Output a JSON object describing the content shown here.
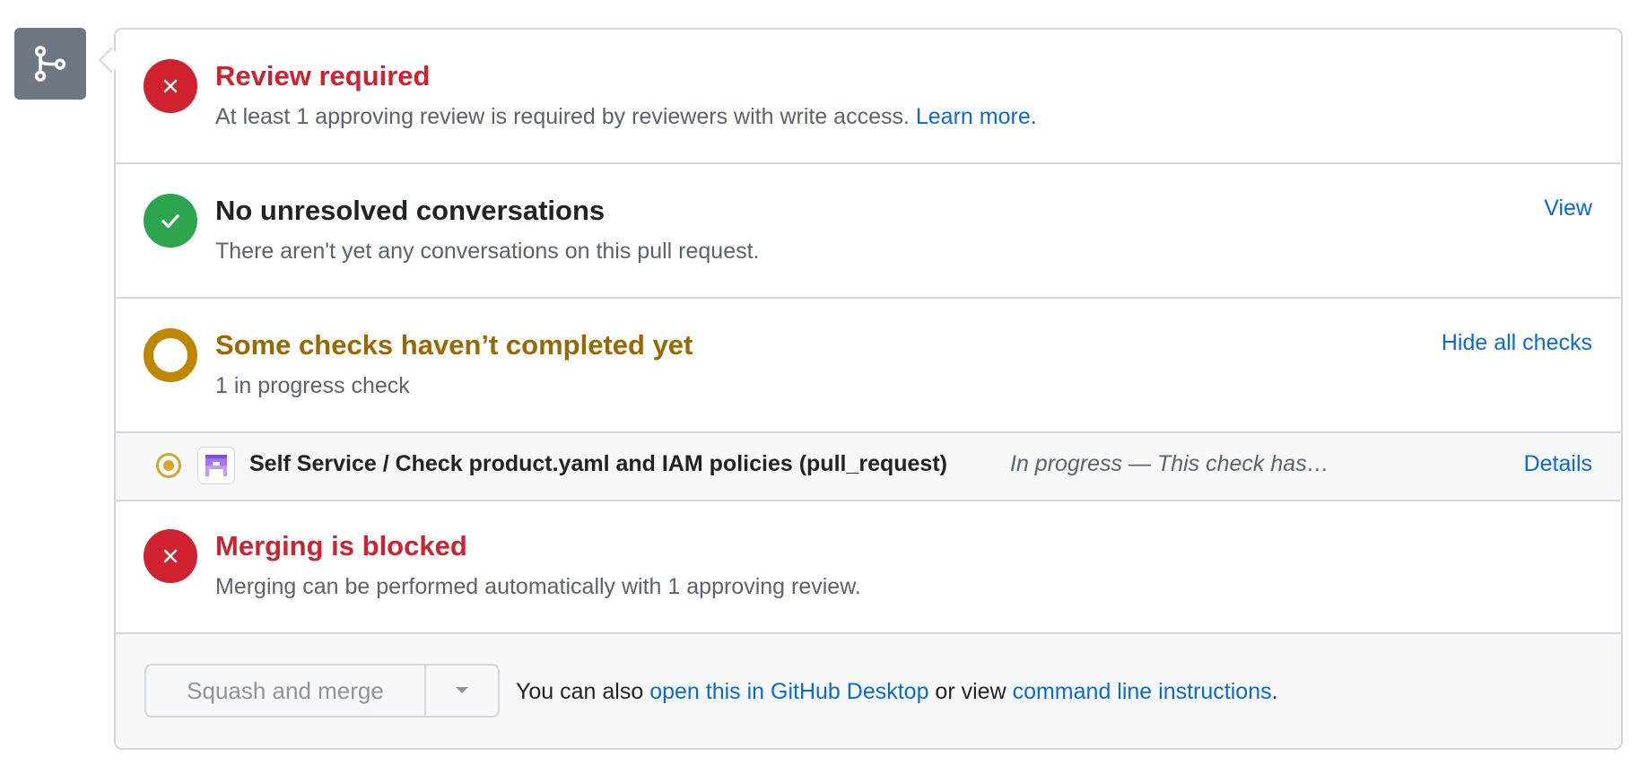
{
  "colors": {
    "danger": "#cf222e",
    "success": "#2da44e",
    "attention": "#bf8700",
    "link": "#0969da",
    "border": "#d0d7de",
    "muted": "#59636e"
  },
  "branch_icon": "git-branch-icon",
  "sections": {
    "review": {
      "icon": "x-circle-icon",
      "title": "Review required",
      "description": "At least 1 approving review is required by reviewers with write access. ",
      "link": "Learn more."
    },
    "conversations": {
      "icon": "check-circle-icon",
      "title": "No unresolved conversations",
      "description": "There aren't yet any conversations on this pull request.",
      "action": "View"
    },
    "checks": {
      "icon": "pending-ring-icon",
      "title": "Some checks haven’t completed yet",
      "description": "1 in progress check",
      "action": "Hide all checks",
      "items": [
        {
          "status_icon": "in-progress-dot-icon",
          "app_icon": "github-app-avatar-icon",
          "name": "Self Service / Check product.yaml and IAM policies (pull_request)",
          "status": "In progress — This check has…",
          "action": "Details"
        }
      ]
    },
    "merging": {
      "icon": "x-circle-icon",
      "title": "Merging is blocked",
      "description": "Merging can be performed automatically with 1 approving review."
    }
  },
  "merge": {
    "button_label": "Squash and merge",
    "dropdown_icon": "triangle-down-icon",
    "note_prefix": "You can also ",
    "desktop_link": "open this in GitHub Desktop",
    "note_middle": " or view ",
    "cli_link": "command line instructions",
    "note_suffix": "."
  }
}
